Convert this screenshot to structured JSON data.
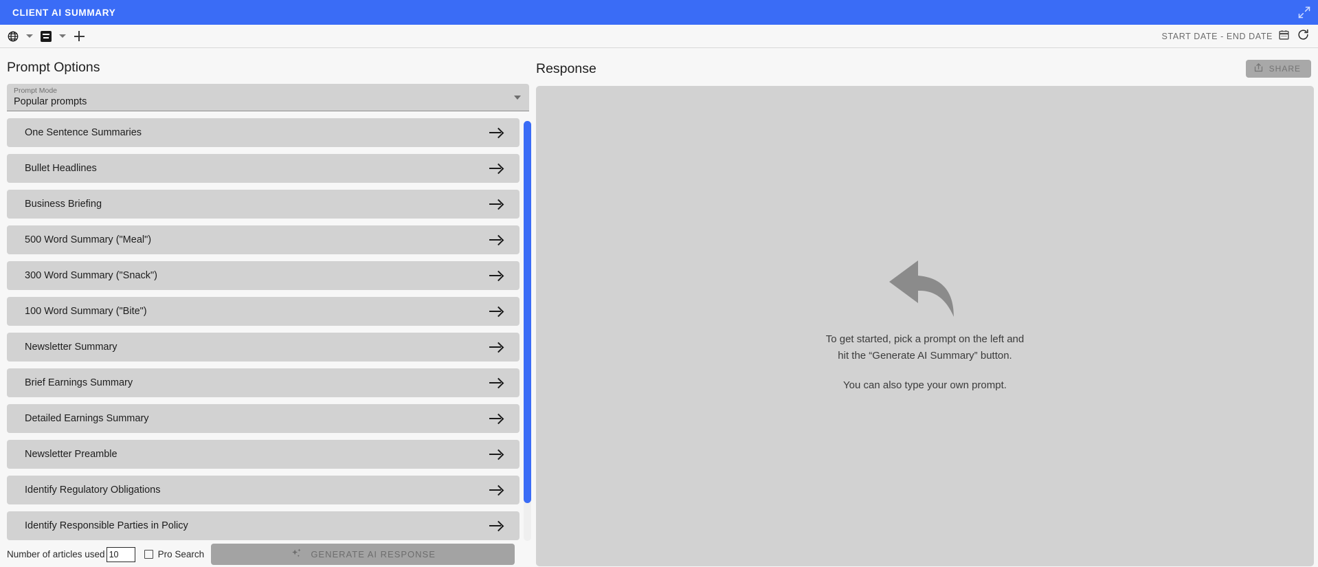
{
  "titlebar": {
    "tab_title": "CLIENT AI SUMMARY",
    "expand_icon": "expand-arrows-icon",
    "accent_color": "#3a6cf6"
  },
  "toolbar": {
    "globe_icon": "globe-icon",
    "globe_caret_icon": "chevron-down-icon",
    "document_icon": "document-icon",
    "document_caret_icon": "chevron-down-icon",
    "add_icon": "plus-icon",
    "date_range_text": "START DATE - END DATE",
    "calendar_icon": "calendar-icon",
    "refresh_icon": "refresh-icon"
  },
  "left_panel": {
    "title": "Prompt Options",
    "prompt_mode": {
      "label": "Prompt Mode",
      "value": "Popular prompts",
      "caret_icon": "chevron-down-icon"
    },
    "prompts": [
      {
        "label": "One Sentence Summaries"
      },
      {
        "label": "Bullet Headlines"
      },
      {
        "label": "Business Briefing"
      },
      {
        "label": "500 Word Summary (\"Meal\")"
      },
      {
        "label": "300 Word Summary (\"Snack\")"
      },
      {
        "label": "100 Word Summary (\"Bite\")"
      },
      {
        "label": "Newsletter Summary"
      },
      {
        "label": "Brief Earnings Summary"
      },
      {
        "label": "Detailed Earnings Summary"
      },
      {
        "label": "Newsletter Preamble"
      },
      {
        "label": "Identify Regulatory Obligations"
      },
      {
        "label": "Identify Responsible Parties in Policy"
      }
    ],
    "item_arrow_icon": "arrow-right-icon",
    "scrollbar_color": "#3a6cf6"
  },
  "bottom_bar": {
    "articles_label": "Number of articles used",
    "articles_value": "10",
    "pro_search_label": "Pro Search",
    "pro_search_checked": false,
    "generate_button_label": "GENERATE AI RESPONSE",
    "generate_button_icon": "sparkle-icon",
    "generate_button_disabled": true
  },
  "right_panel": {
    "title": "Response",
    "share_button_label": "SHARE",
    "share_button_icon": "share-icon",
    "share_button_disabled": true,
    "empty_state": {
      "icon": "curved-reply-arrow-icon",
      "line1": "To get started, pick a prompt on the left and",
      "line2": "hit the “Generate AI Summary” button.",
      "line3": "You can also type your own prompt."
    }
  }
}
